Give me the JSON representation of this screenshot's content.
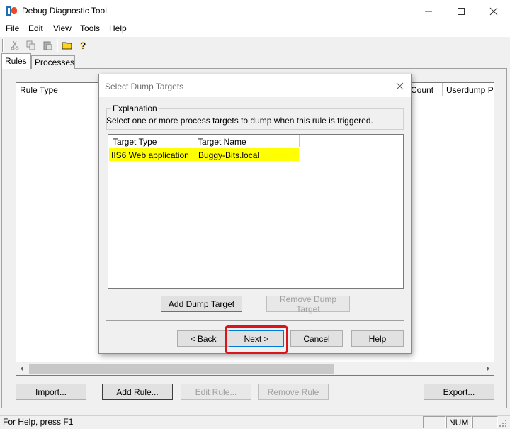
{
  "window": {
    "title": "Debug Diagnostic Tool",
    "app_icon": "debugdiag-app-icon"
  },
  "menu": [
    "File",
    "Edit",
    "View",
    "Tools",
    "Help"
  ],
  "toolbar": {
    "icons": [
      "cut-icon",
      "copy-icon",
      "paste-icon",
      "folder-open-icon",
      "help-icon"
    ]
  },
  "tabs": [
    {
      "label": "Rules",
      "active": true
    },
    {
      "label": "Processes",
      "active": false
    }
  ],
  "rules_list": {
    "columns": [
      "Rule Type",
      "Count",
      "Userdump Pat"
    ]
  },
  "bottom_buttons": {
    "import": "Import...",
    "add_rule": "Add Rule...",
    "edit_rule": "Edit Rule...",
    "remove_rule": "Remove Rule",
    "export": "Export..."
  },
  "statusbar": {
    "text": "For Help, press F1",
    "num": "NUM"
  },
  "dialog": {
    "title": "Select Dump Targets",
    "explanation_label": "Explanation",
    "explanation_text": "Select one or more process targets to dump when this rule is triggered.",
    "columns": [
      "Target Type",
      "Target Name"
    ],
    "targets": [
      {
        "type": "IIS6 Web application ...",
        "name": "Buggy-Bits.local",
        "selected": true
      }
    ],
    "add_target": "Add Dump Target",
    "remove_target": "Remove Dump Target",
    "back": "< Back",
    "next": "Next >",
    "cancel": "Cancel",
    "help": "Help"
  },
  "colors": {
    "selection_highlight": "#ffff00",
    "annotation_red": "#d9141b"
  }
}
